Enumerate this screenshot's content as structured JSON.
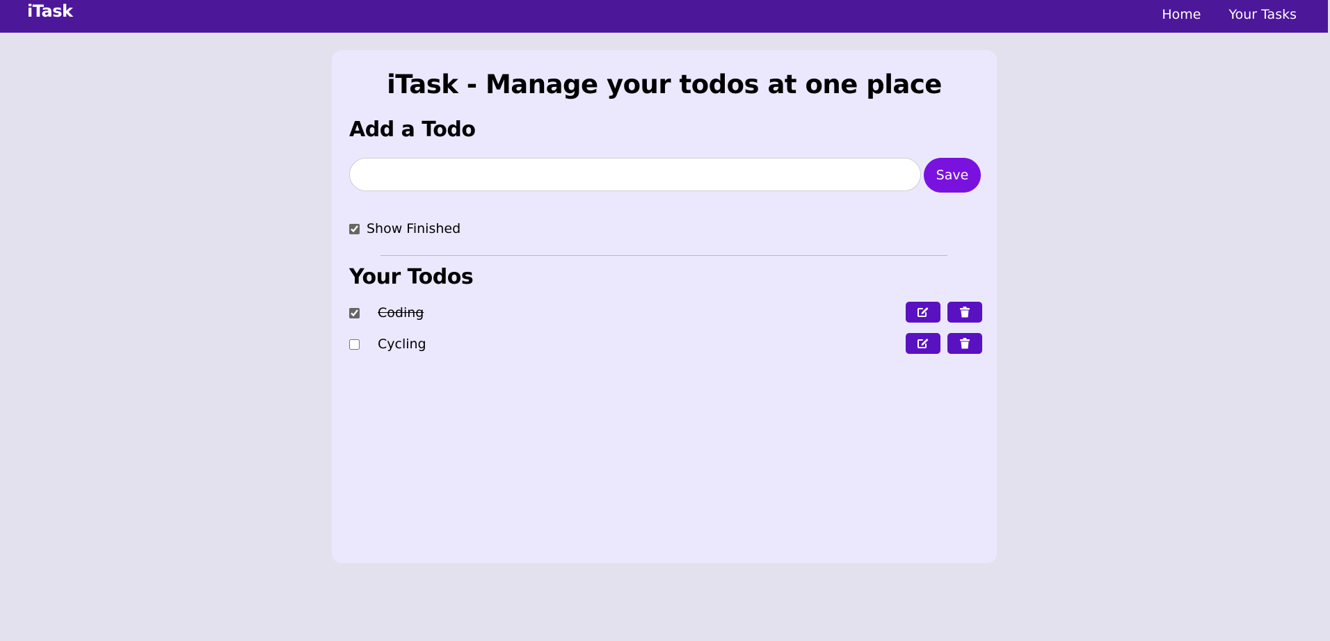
{
  "nav": {
    "brand": "iTask",
    "links": [
      {
        "label": "Home"
      },
      {
        "label": "Your Tasks"
      }
    ]
  },
  "main": {
    "title": "iTask - Manage your todos at one place",
    "add_heading": "Add a Todo",
    "input": {
      "value": "",
      "placeholder": ""
    },
    "save_label": "Save",
    "show_finished": {
      "label": "Show Finished",
      "checked": true
    },
    "todos_heading": "Your Todos",
    "todos": [
      {
        "text": "Coding",
        "done": true
      },
      {
        "text": "Cycling",
        "done": false
      }
    ]
  },
  "icons": {
    "edit": "edit-icon",
    "delete": "trash-icon"
  },
  "colors": {
    "navbar": "#4c1799",
    "save_button": "#7a12df",
    "action_button": "#5a11c2",
    "card": "#ebe8fd",
    "page": "#e3e1ee"
  }
}
